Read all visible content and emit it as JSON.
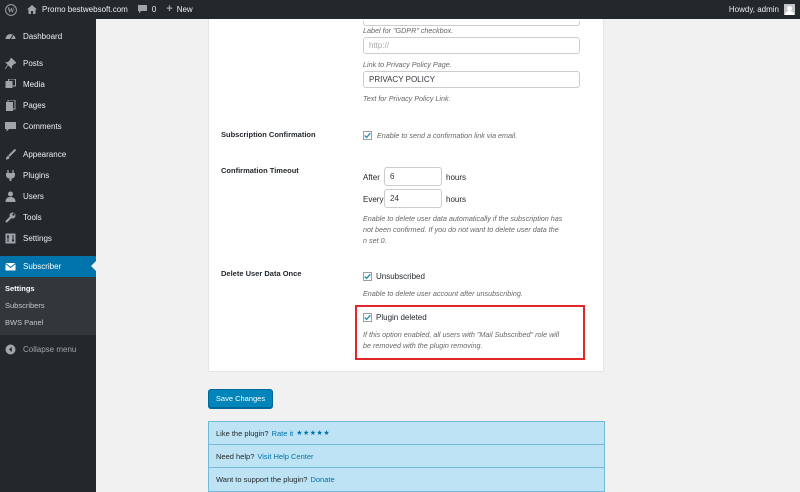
{
  "adminbar": {
    "site_name": "Promo bestwebsoft.com",
    "comments_count": "0",
    "new_label": "New",
    "howdy": "Howdy, admin"
  },
  "sidebar": {
    "items": [
      {
        "label": "Dashboard",
        "icon": "dashboard-icon"
      },
      {
        "label": "Posts",
        "icon": "pin-icon"
      },
      {
        "label": "Media",
        "icon": "media-icon"
      },
      {
        "label": "Pages",
        "icon": "pages-icon"
      },
      {
        "label": "Comments",
        "icon": "comment-icon"
      },
      {
        "label": "Appearance",
        "icon": "brush-icon"
      },
      {
        "label": "Plugins",
        "icon": "plugin-icon"
      },
      {
        "label": "Users",
        "icon": "users-icon"
      },
      {
        "label": "Tools",
        "icon": "wrench-icon"
      },
      {
        "label": "Settings",
        "icon": "settings-icon"
      }
    ],
    "current": {
      "label": "Subscriber",
      "icon": "envelope-icon"
    },
    "submenu": [
      "Settings",
      "Subscribers",
      "BWS Panel"
    ],
    "collapse": "Collapse menu"
  },
  "form": {
    "gdpr_label_desc": "Label for \"GDPR\" checkbox.",
    "privacy_url_placeholder": "http://",
    "privacy_url_desc": "Link to Privacy Policy Page.",
    "privacy_text_value": "PRIVACY POLICY",
    "privacy_text_desc": "Text for Privacy Policy Link.",
    "subscription_confirmation": {
      "label": "Subscription Confirmation",
      "checkbox_desc": "Enable to send a confirmation link via email.",
      "checked": true
    },
    "confirmation_timeout": {
      "label": "Confirmation Timeout",
      "after_label": "After",
      "after_value": "6",
      "after_unit": "hours",
      "every_label": "Every",
      "every_value": "24",
      "every_unit": "hours",
      "desc_line1": "Enable to delete user data automatically if the subscription has",
      "desc_line2": "not been confirmed. If you do not want to delete user data the",
      "desc_line3": "n set 0."
    },
    "delete_user_data": {
      "label": "Delete User Data Once",
      "unsubscribed_label": "Unsubscribed",
      "unsubscribed_checked": true,
      "unsubscribed_desc": "Enable to delete user account after unsubscribing.",
      "plugin_deleted_label": "Plugin deleted",
      "plugin_deleted_checked": true,
      "plugin_deleted_desc1": "If this option enabled, all users with \"Mail Subscribed\" role will",
      "plugin_deleted_desc2": "be removed with the plugin removing."
    }
  },
  "save_button": "Save Changes",
  "info": {
    "row1_text": "Like the plugin?",
    "row1_link": "Rate it",
    "row1_stars": "★★★★★",
    "row2_text": "Need help?",
    "row2_link": "Visit Help Center",
    "row3_text": "Want to support the plugin?",
    "row3_link": "Donate"
  },
  "colors": {
    "adminbar_bg": "#23282d",
    "accent": "#0073aa",
    "highlight_border": "#e3262a",
    "info_bg": "#bde3f4"
  }
}
